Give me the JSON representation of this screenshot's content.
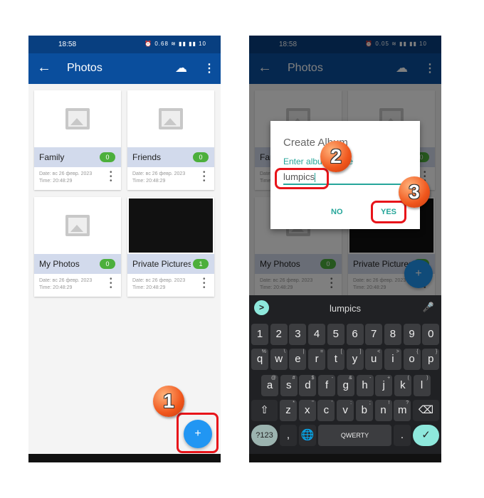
{
  "status": {
    "time": "18:58",
    "icons": "⏰ 0.68 ≋ ▮▮ ▮▮ 10"
  },
  "status_right": {
    "time": "18:58",
    "icons": "⏰ 0.05 ≋ ▮▮ ▮▮ 10"
  },
  "appbar": {
    "title": "Photos",
    "back_icon": "←",
    "cloud_icon": "☁",
    "more_icon": "⋮"
  },
  "albums": [
    {
      "name": "Family",
      "count": "0",
      "date": "Date: вс 26 февр. 2023",
      "time": "Time:  20:48:29",
      "thumb": "placeholder"
    },
    {
      "name": "Friends",
      "count": "0",
      "date": "Date: вс 26 февр. 2023",
      "time": "Time:  20:48:29",
      "thumb": "placeholder"
    },
    {
      "name": "My Photos",
      "count": "0",
      "date": "Date: вс 26 февр. 2023",
      "time": "Time:  20:48:29",
      "thumb": "placeholder"
    },
    {
      "name": "Private Pictures",
      "count": "1",
      "date": "Date: вс 26 февр. 2023",
      "time": "Time:  20:48:29",
      "thumb": "black"
    }
  ],
  "fab": {
    "icon": "folder-plus-icon",
    "glyph": "+"
  },
  "callouts": [
    "1",
    "2",
    "3"
  ],
  "dialog": {
    "title": "Create Album",
    "label": "Enter album name",
    "value": "lumpics",
    "no": "NO",
    "yes": "YES"
  },
  "keyboard": {
    "suggestion": "lumpics",
    "arrow": ">",
    "mic": "🎤",
    "row1": [
      "1",
      "2",
      "3",
      "4",
      "5",
      "6",
      "7",
      "8",
      "9",
      "0"
    ],
    "row2": [
      [
        "q",
        "%"
      ],
      [
        "w",
        "\\"
      ],
      [
        "e",
        "|"
      ],
      [
        "r",
        "="
      ],
      [
        "t",
        "["
      ],
      [
        "y",
        "]"
      ],
      [
        "u",
        "<"
      ],
      [
        "i",
        ">"
      ],
      [
        "o",
        "{"
      ],
      [
        "p",
        "}"
      ]
    ],
    "row3": [
      [
        "a",
        "@"
      ],
      [
        "s",
        "#"
      ],
      [
        "d",
        "$"
      ],
      [
        "f",
        "-"
      ],
      [
        "g",
        "&"
      ],
      [
        "h",
        "-"
      ],
      [
        "j",
        "+"
      ],
      [
        "k",
        "("
      ],
      [
        "l",
        ")"
      ]
    ],
    "row4": [
      [
        "z",
        "*"
      ],
      [
        "x",
        "\""
      ],
      [
        "c",
        "'"
      ],
      [
        "v",
        ":"
      ],
      [
        "b",
        ";"
      ],
      [
        "n",
        "!"
      ],
      [
        "m",
        "?"
      ]
    ],
    "shift": "⇧",
    "backspace": "⌫",
    "symbols": "?123",
    "comma": ",",
    "globe": "🌐",
    "space": "QWERTY",
    "period": ".",
    "enter": "✓"
  },
  "colors": {
    "appbar": "#0a4e9d",
    "fab": "#2196f3",
    "accent": "#26a69a",
    "badge": "#4caf3c",
    "highlight": "#e8141a"
  }
}
